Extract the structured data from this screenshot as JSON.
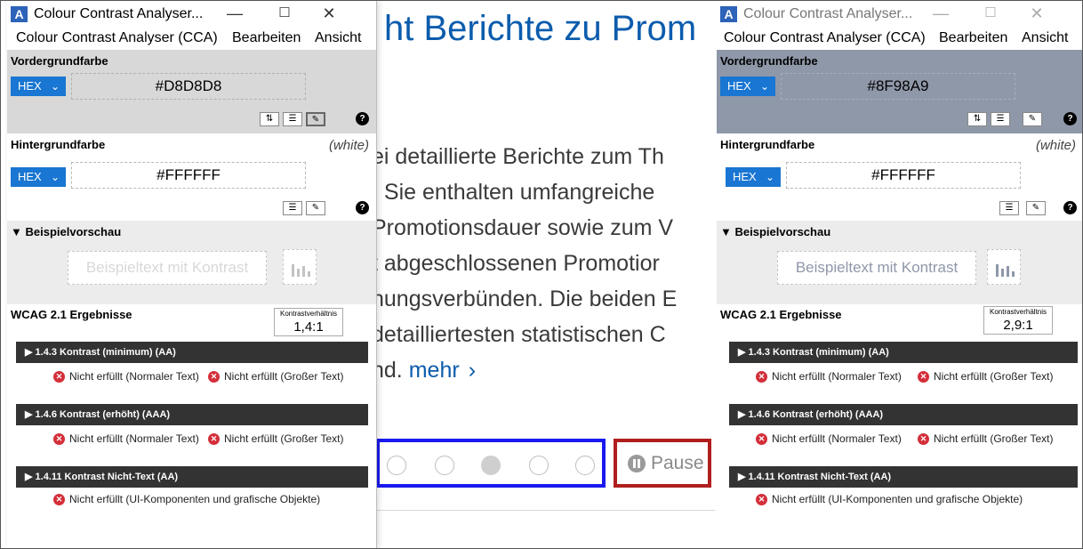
{
  "background_page": {
    "heading": "ht Berichte zu Prom",
    "paragraph_lines": [
      "ei detaillierte Berichte zum Th",
      ". Sie enthalten umfangreiche",
      "Promotionsdauer sowie zum V",
      "t abgeschlossenen Promotior",
      "hungsverbünden. Die beiden E",
      "detailliertesten statistischen C",
      "nd."
    ],
    "more_link": "mehr",
    "more_chevron": "›",
    "carousel_dot_count": 5,
    "carousel_active_dot": 3,
    "pause_label": "Pause",
    "colors": {
      "heading": "#0b5cad",
      "dots_highlight": "#1a1af0",
      "pause_highlight": "#b01e1e"
    }
  },
  "window_left": {
    "title": "Colour Contrast Analyser...",
    "app_icon_glyph": "A",
    "window_controls": {
      "minimize": "—",
      "maximize": "☐",
      "close": "✕"
    },
    "menu": [
      "Colour Contrast Analyser (CCA)",
      "Bearbeiten",
      "Ansicht"
    ],
    "foreground": {
      "label": "Vordergrundfarbe",
      "format": "HEX",
      "value": "#D8D8D8",
      "swatch": "#D8D8D8"
    },
    "foreground_tools": [
      "swap-icon",
      "adjust-icon",
      "eyedropper-icon",
      "help-icon"
    ],
    "background": {
      "label": "Hintergrundfarbe",
      "name_hint": "(white)",
      "format": "HEX",
      "value": "#FFFFFF"
    },
    "background_tools": [
      "adjust-icon",
      "eyedropper-icon",
      "help-icon"
    ],
    "preview": {
      "label": "▼ Beispielvorschau",
      "sample_text": "Beispieltext mit Kontrast",
      "icon": "chart-preview-icon"
    },
    "wcag": {
      "title": "WCAG 2.1 Ergebnisse",
      "ratio_label": "Kontrastverhältnis",
      "ratio_value": "1,4:1",
      "criteria": [
        {
          "label": "▶ 1.4.3 Kontrast (minimum) (AA)",
          "results": [
            "Nicht erfüllt (Normaler Text)",
            "Nicht erfüllt (Großer Text)"
          ]
        },
        {
          "label": "▶ 1.4.6 Kontrast (erhöht) (AAA)",
          "results": [
            "Nicht erfüllt (Normaler Text)",
            "Nicht erfüllt (Großer Text)"
          ]
        },
        {
          "label": "▶ 1.4.11 Kontrast Nicht-Text (AA)",
          "results": [
            "Nicht erfüllt (UI-Komponenten und grafische Objekte)"
          ]
        }
      ]
    }
  },
  "window_right": {
    "title": "Colour Contrast Analyser...",
    "app_icon_glyph": "A",
    "window_controls": {
      "minimize": "—",
      "maximize": "☐",
      "close": "✕"
    },
    "menu": [
      "Colour Contrast Analyser (CCA)",
      "Bearbeiten",
      "Ansicht"
    ],
    "foreground": {
      "label": "Vordergrundfarbe",
      "format": "HEX",
      "value": "#8F98A9",
      "swatch": "#8F98A9"
    },
    "foreground_tools": [
      "swap-icon",
      "adjust-icon",
      "eyedropper-icon",
      "help-icon"
    ],
    "background": {
      "label": "Hintergrundfarbe",
      "name_hint": "(white)",
      "format": "HEX",
      "value": "#FFFFFF"
    },
    "background_tools": [
      "adjust-icon",
      "eyedropper-icon",
      "help-icon"
    ],
    "preview": {
      "label": "▼ Beispielvorschau",
      "sample_text": "Beispieltext mit Kontrast",
      "icon": "chart-preview-icon"
    },
    "wcag": {
      "title": "WCAG 2.1 Ergebnisse",
      "ratio_label": "Kontrastverhältnis",
      "ratio_value": "2,9:1",
      "criteria": [
        {
          "label": "▶ 1.4.3 Kontrast (minimum) (AA)",
          "results": [
            "Nicht erfüllt (Normaler Text)",
            "Nicht erfüllt (Großer Text)"
          ]
        },
        {
          "label": "▶ 1.4.6 Kontrast (erhöht) (AAA)",
          "results": [
            "Nicht erfüllt (Normaler Text)",
            "Nicht erfüllt (Großer Text)"
          ]
        },
        {
          "label": "▶ 1.4.11 Kontrast Nicht-Text (AA)",
          "results": [
            "Nicht erfüllt (UI-Komponenten und grafische Objekte)"
          ]
        }
      ]
    }
  },
  "icons": {
    "dropdown": "chevron-down-icon",
    "fail": "fail-x-icon",
    "minimize": "minimize-icon",
    "maximize": "maximize-icon",
    "close": "close-icon"
  }
}
